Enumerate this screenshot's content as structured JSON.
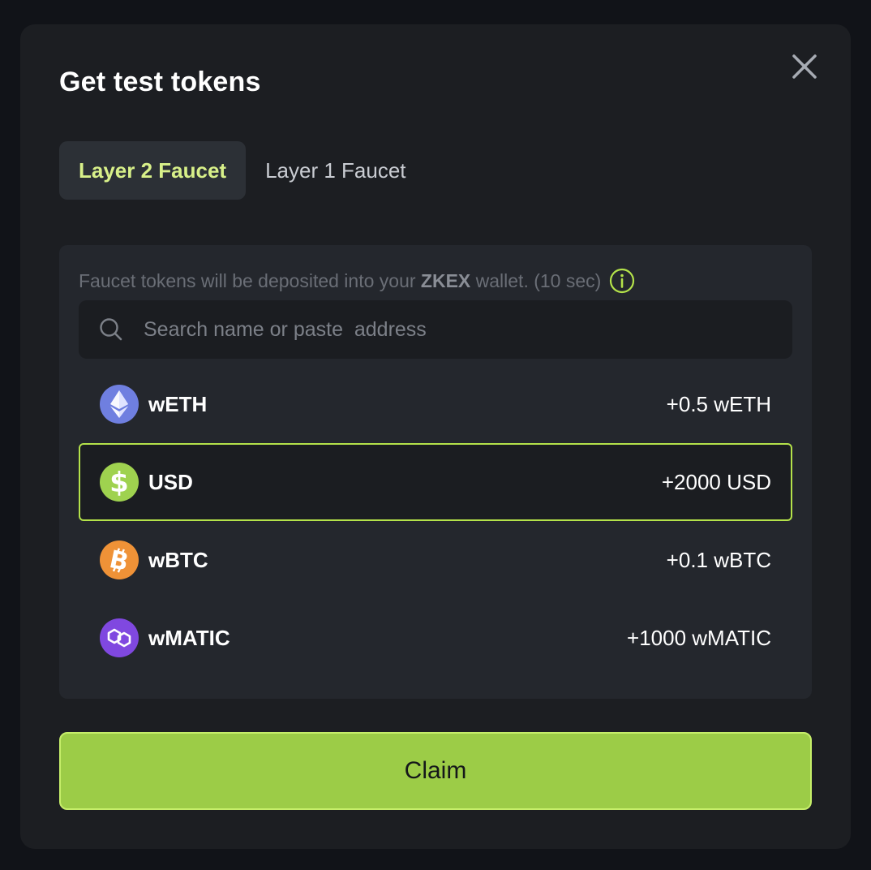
{
  "modal": {
    "title": "Get test tokens",
    "close_icon": "close-icon"
  },
  "tabs": [
    {
      "label": "Layer 2 Faucet",
      "active": true
    },
    {
      "label": "Layer 1 Faucet",
      "active": false
    }
  ],
  "notice": {
    "prefix": "Faucet tokens will be deposited into your ",
    "emphasis": "ZKEX",
    "suffix": " wallet. (10 sec)",
    "icon": "info-icon"
  },
  "search": {
    "placeholder": "Search name or paste  address",
    "value": "",
    "icon": "search-icon"
  },
  "tokens": [
    {
      "symbol": "wETH",
      "amount": "+0.5 wETH",
      "icon": "ethereum-icon",
      "color": "#6f7fe0",
      "selected": false
    },
    {
      "symbol": "USD",
      "amount": "+2000 USD",
      "icon": "dollar-icon",
      "color": "#9fd24f",
      "selected": true
    },
    {
      "symbol": "wBTC",
      "amount": "+0.1 wBTC",
      "icon": "bitcoin-icon",
      "color": "#ef9237",
      "selected": false
    },
    {
      "symbol": "wMATIC",
      "amount": "+1000 wMATIC",
      "icon": "polygon-icon",
      "color": "#8048e0",
      "selected": false
    }
  ],
  "claim": {
    "label": "Claim"
  },
  "colors": {
    "accent": "#9ccc47",
    "accent_text": "#d8f089",
    "selected_border": "#b4e24a",
    "modal_bg": "#1c1e22",
    "panel_bg": "#24272d"
  }
}
